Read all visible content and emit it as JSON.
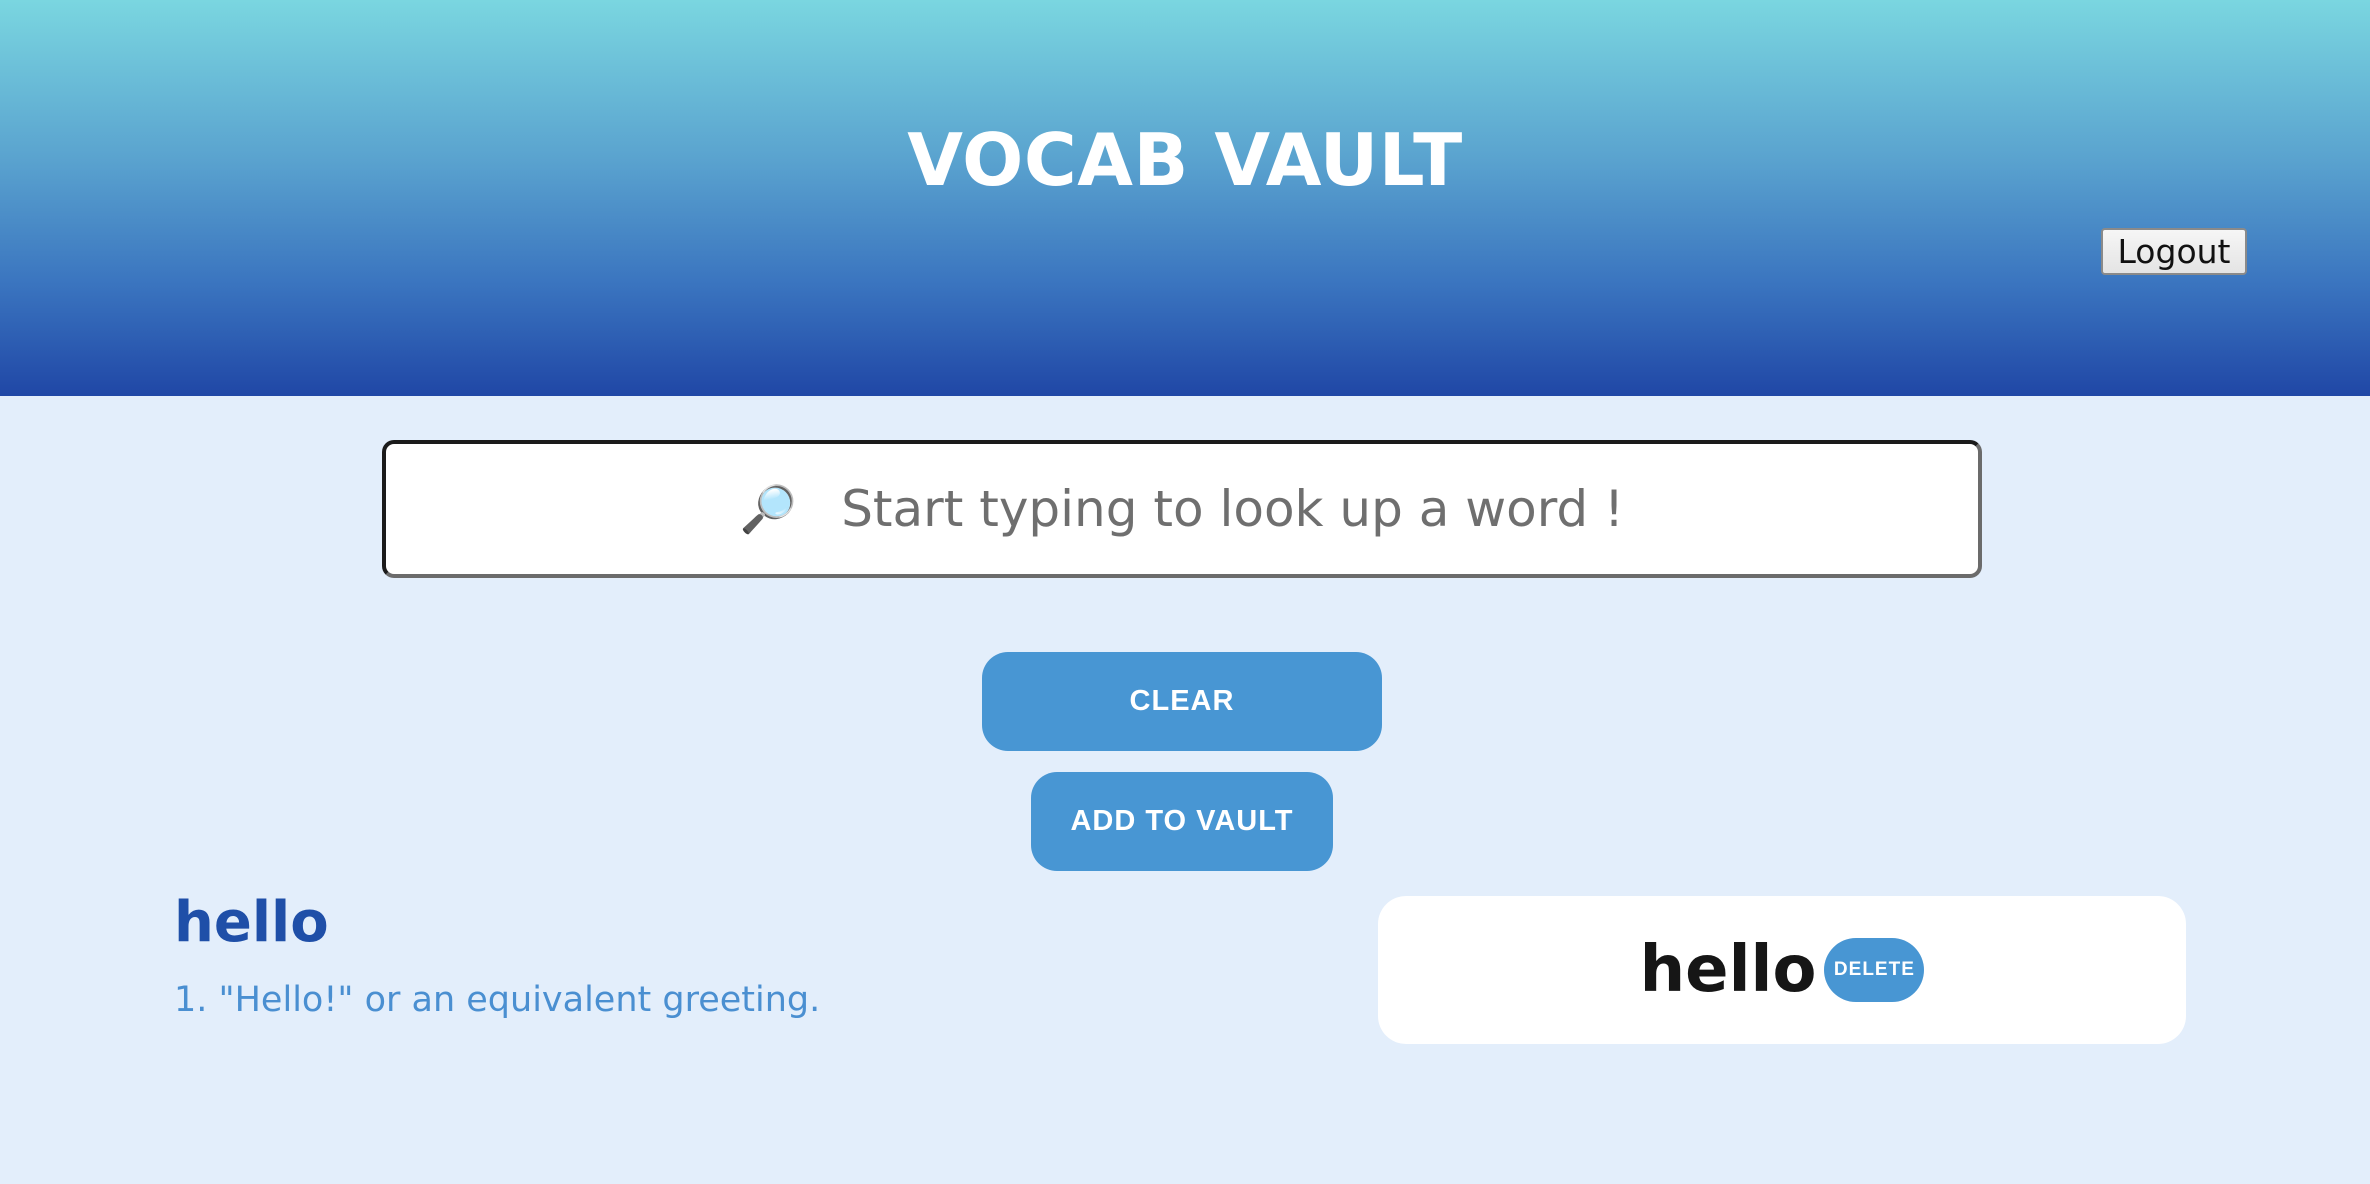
{
  "header": {
    "title": "VOCAB VAULT",
    "logout_label": "Logout"
  },
  "search": {
    "icon": "magnifier-icon",
    "placeholder": "Start typing to look up a word !"
  },
  "actions": {
    "clear_label": "CLEAR",
    "add_label": "ADD TO VAULT"
  },
  "result": {
    "word": "hello",
    "definitions": [
      "1. \"Hello!\" or an equivalent greeting."
    ]
  },
  "vault": {
    "items": [
      {
        "word": "hello",
        "delete_label": "DELETE"
      }
    ]
  },
  "colors": {
    "accent": "#4896d3",
    "heading_blue": "#1f4fa8",
    "definition_blue": "#4a8fd1",
    "page_bg": "#e3eefb"
  }
}
